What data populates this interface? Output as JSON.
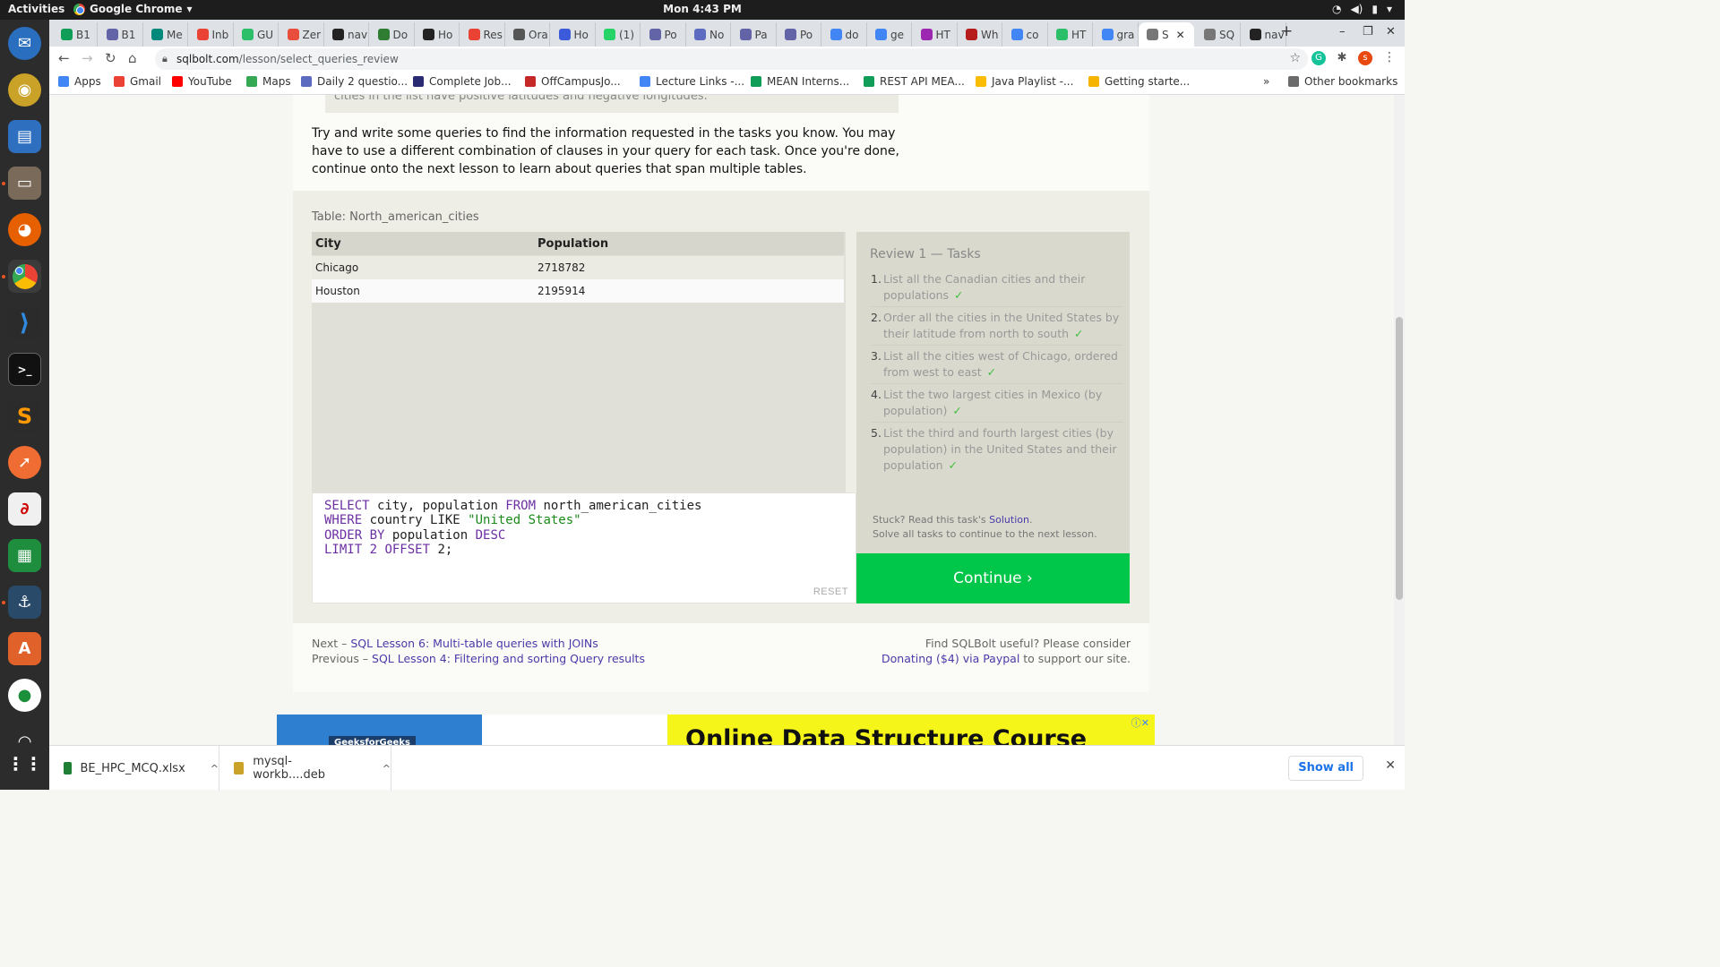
{
  "os": {
    "activities": "Activities",
    "app_name": "Google Chrome",
    "clock": "Mon  4:43 PM"
  },
  "tabs": [
    {
      "label": "B1",
      "color": "#0f9d58"
    },
    {
      "label": "B1",
      "color": "#6264a7"
    },
    {
      "label": "Me",
      "color": "#00897b"
    },
    {
      "label": "Inb",
      "color": "#ea4335"
    },
    {
      "label": "GU",
      "color": "#2bbf6a"
    },
    {
      "label": "Zer",
      "color": "#e94e3c"
    },
    {
      "label": "nav",
      "color": "#222222"
    },
    {
      "label": "Do",
      "color": "#2e7d32"
    },
    {
      "label": "Ho",
      "color": "#222222"
    },
    {
      "label": "Res",
      "color": "#ea4335"
    },
    {
      "label": "Ora",
      "color": "#555555"
    },
    {
      "label": "Ho",
      "color": "#3b5bdb"
    },
    {
      "label": "(1)",
      "color": "#25d366"
    },
    {
      "label": "Po",
      "color": "#6264a7"
    },
    {
      "label": "No",
      "color": "#5c6bc0"
    },
    {
      "label": "Pa",
      "color": "#6264a7"
    },
    {
      "label": "Po",
      "color": "#6264a7"
    },
    {
      "label": "do",
      "color": "#4285f4"
    },
    {
      "label": "ge",
      "color": "#4285f4"
    },
    {
      "label": "HT",
      "color": "#9c27b0"
    },
    {
      "label": "Wh",
      "color": "#b71c1c"
    },
    {
      "label": "co",
      "color": "#4285f4"
    },
    {
      "label": "HT",
      "color": "#2bbf6a"
    },
    {
      "label": "gra",
      "color": "#4285f4"
    },
    {
      "label": "S",
      "color": "#777777",
      "active": true
    },
    {
      "label": "SQ",
      "color": "#777777"
    },
    {
      "label": "nav",
      "color": "#222222"
    }
  ],
  "address_bar": {
    "domain": "sqlbolt.com",
    "path": "/lesson/select_queries_review"
  },
  "profile_initial": "s",
  "bookmarks": [
    {
      "label": "Apps",
      "color": "#4285f4"
    },
    {
      "label": "Gmail",
      "color": "#ea4335"
    },
    {
      "label": "YouTube",
      "color": "#ff0000"
    },
    {
      "label": "Maps",
      "color": "#34a853"
    },
    {
      "label": "Daily 2 questio...",
      "color": "#5c6bc0"
    },
    {
      "label": "Complete Job...",
      "color": "#2a2a72"
    },
    {
      "label": "OffCampusJo...",
      "color": "#c62828"
    },
    {
      "label": "Lecture Links -...",
      "color": "#4285f4"
    },
    {
      "label": "MEAN Interns...",
      "color": "#0f9d58"
    },
    {
      "label": "REST API MEA...",
      "color": "#0f9d58"
    },
    {
      "label": "Java Playlist -...",
      "color": "#fbbc05"
    },
    {
      "label": "Getting starte...",
      "color": "#f4b400"
    }
  ],
  "other_bookmarks": "Other bookmarks",
  "lesson": {
    "cut_text": "cities in the list have positive latitudes and negative longitudes.",
    "intro": "Try and write some queries to find the information requested in the tasks you know. You may have to use a different combination of clauses in your query for each task. Once you're done, continue onto the next lesson to learn about queries that span multiple tables.",
    "table_caption": "Table: North_american_cities",
    "table": {
      "headers": [
        "City",
        "Population"
      ],
      "rows": [
        [
          "Chicago",
          "2718782"
        ],
        [
          "Houston",
          "2195914"
        ]
      ]
    },
    "query": {
      "l1_kw1": "SELECT",
      "l1_mid": " city, population ",
      "l1_kw2": "FROM",
      "l1_end": " north_american_cities",
      "l2_kw": "WHERE",
      "l2_mid": " country ",
      "l2_kw2": "LIKE",
      "l2_str": " \"United States\"",
      "l3_kw": "ORDER BY",
      "l3_mid": " population ",
      "l3_kw2": "DESC",
      "l4_kw": "LIMIT",
      "l4_mid": " 2 ",
      "l4_kw2": "OFFSET",
      "l4_end": " 2;"
    },
    "reset_label": "RESET",
    "tasks_title": "Review 1 — Tasks",
    "tasks": [
      {
        "num": "1.",
        "text": "List all the Canadian cities and their populations",
        "check": "✓"
      },
      {
        "num": "2.",
        "text": "Order all the cities in the United States by their latitude from north to south",
        "check": "✓"
      },
      {
        "num": "3.",
        "text": "List all the cities west of Chicago, ordered from west to east",
        "check": "✓"
      },
      {
        "num": "4.",
        "text": "List the two largest cities in Mexico (by population)",
        "check": "✓"
      },
      {
        "num": "5.",
        "text": "List the third and fourth largest cities (by population) in the United States and their population",
        "check": "✓"
      }
    ],
    "stuck_prefix": "Stuck? Read this task's ",
    "solution_link": "Solution",
    "stuck_suffix": ".",
    "solve_all": "Solve all tasks to continue to the next lesson.",
    "continue_label": "Continue ›"
  },
  "footer": {
    "next_prefix": "Next – ",
    "next_link": "SQL Lesson 6: Multi-table queries with JOINs",
    "prev_prefix": "Previous – ",
    "prev_link": "SQL Lesson 4: Filtering and sorting Query results",
    "find_useful": "Find SQLBolt useful? Please consider",
    "donate_link": "Donating ($4) via Paypal",
    "donate_suffix": " to support our site."
  },
  "ad": {
    "brand": "GeeksforGeeks",
    "headline": "Online Data Structure Course"
  },
  "downloads": {
    "items": [
      {
        "name": "BE_HPC_MCQ.xlsx",
        "color": "#1e7e34"
      },
      {
        "name": "mysql-workb....deb",
        "color": "#c9a227"
      }
    ],
    "show_all": "Show all"
  }
}
